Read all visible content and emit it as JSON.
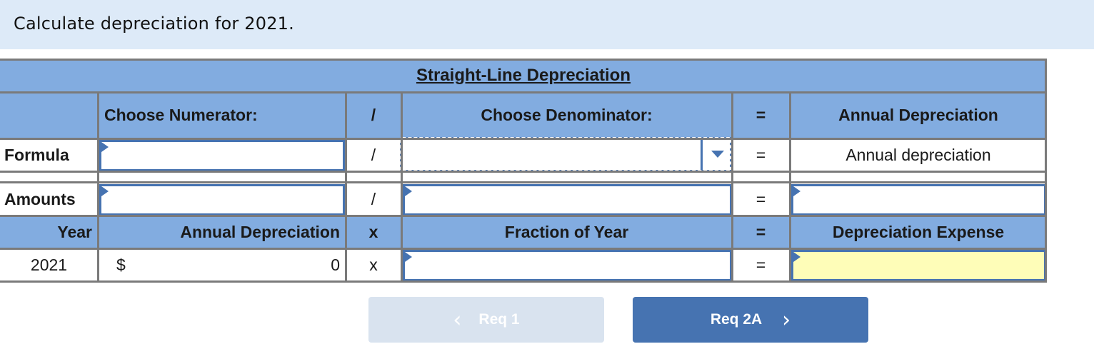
{
  "instruction": "Calculate depreciation for 2021.",
  "table": {
    "title": "Straight-Line Depreciation",
    "header": {
      "numerator_label": "Choose Numerator:",
      "divide_symbol": "/",
      "denominator_label": "Choose Denominator:",
      "equals_symbol": "=",
      "result_label": "Annual Depreciation"
    },
    "formula_row": {
      "label": "Formula",
      "numerator_value": "",
      "divide_symbol": "/",
      "denominator_selected": "",
      "equals_symbol": "=",
      "result_text": "Annual depreciation"
    },
    "amounts_row": {
      "label": "Amounts",
      "numerator_value": "",
      "divide_symbol": "/",
      "denominator_value": "",
      "equals_symbol": "=",
      "result_value": ""
    },
    "expense_header": {
      "year_label": "Year",
      "annual_dep_label": "Annual Depreciation",
      "times_symbol": "x",
      "fraction_label": "Fraction of Year",
      "equals_symbol": "=",
      "expense_label": "Depreciation Expense"
    },
    "expense_row": {
      "year": "2021",
      "currency_symbol": "$",
      "annual_dep_value": "0",
      "times_symbol": "x",
      "fraction_value": "",
      "equals_symbol": "=",
      "expense_value": ""
    }
  },
  "navigation": {
    "prev_label": "Req 1",
    "next_label": "Req 2A",
    "prev_icon": "chevron-left-icon",
    "next_icon": "chevron-right-icon"
  },
  "colors": {
    "header_blue": "#82ace0",
    "input_border": "#4673b1",
    "answer_yellow": "#fefdb8",
    "instruction_bg": "#ddeaf8"
  }
}
